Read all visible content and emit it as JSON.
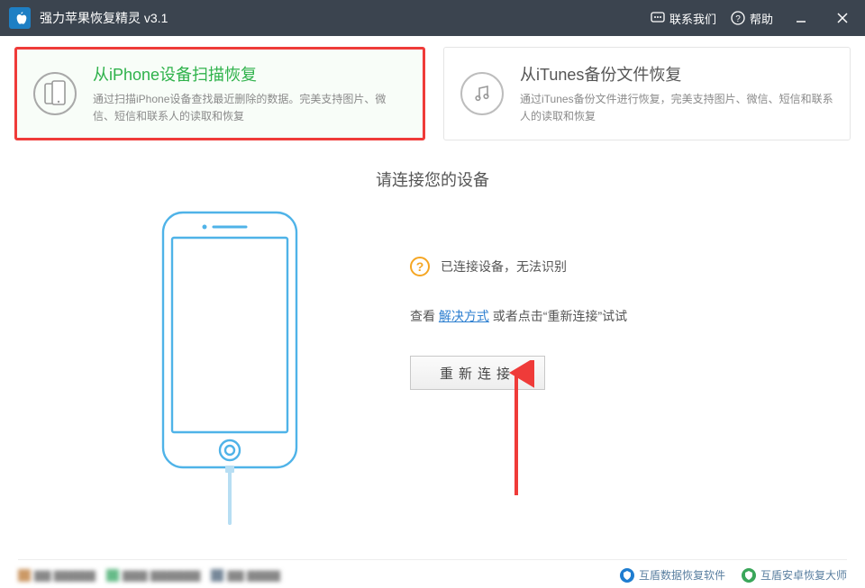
{
  "titlebar": {
    "app_title": "强力苹果恢复精灵 v3.1",
    "contact_label": "联系我们",
    "help_label": "帮助"
  },
  "modes": {
    "iphone": {
      "title": "从iPhone设备扫描恢复",
      "desc": "通过扫描iPhone设备查找最近删除的数据。完美支持图片、微信、短信和联系人的读取和恢复"
    },
    "itunes": {
      "title": "从iTunes备份文件恢复",
      "desc": "通过iTunes备份文件进行恢复，完美支持图片、微信、短信和联系人的读取和恢复"
    }
  },
  "main": {
    "heading": "请连接您的设备",
    "status_msg": "已连接设备，无法识别",
    "hint_prefix": "查看 ",
    "hint_link": "解决方式",
    "hint_middle": " 或者点击“",
    "hint_action": "重新连接",
    "hint_suffix": "”试试",
    "reconnect_button": "重新连接"
  },
  "footer": {
    "link1": "互盾数据恢复软件",
    "link2": "互盾安卓恢复大师"
  }
}
